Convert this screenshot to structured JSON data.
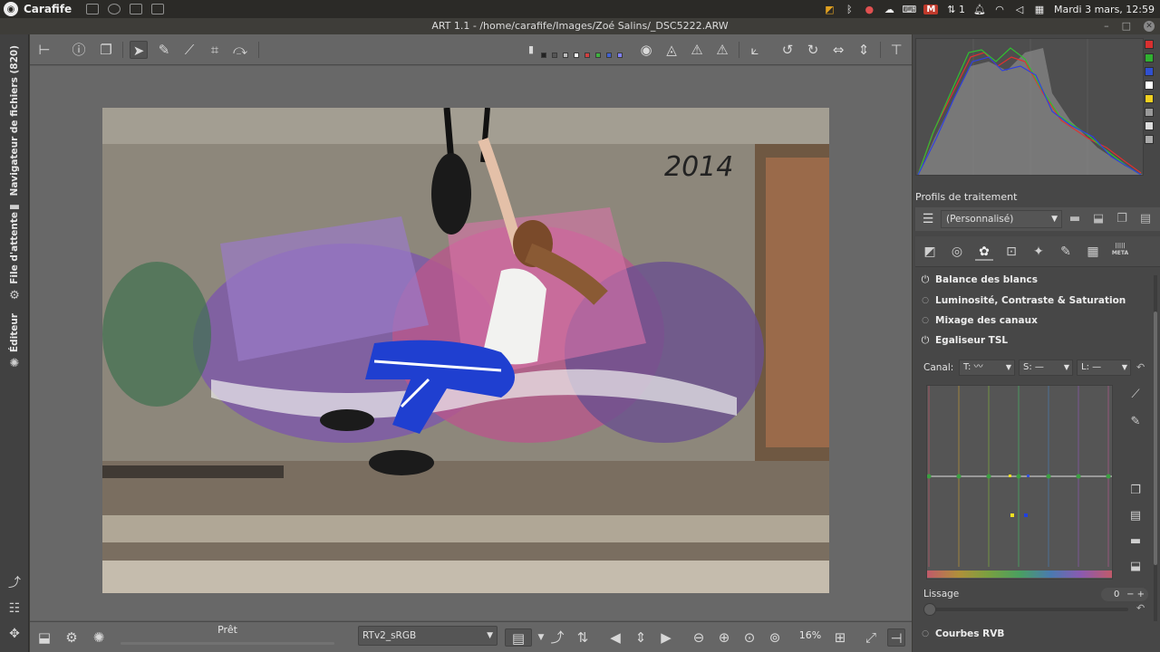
{
  "top_panel": {
    "app_name": "Carafife",
    "date_time": "Mardi 3 mars, 12:59",
    "notification_badge": "M",
    "notification_count": "1"
  },
  "window": {
    "title": "ART 1.1 - /home/carafife/Images/Zoé Salins/_DSC5222.ARW"
  },
  "left_tabs": {
    "file_browser": "Navigateur de fichiers (820)",
    "queue": "File d'attente",
    "editor": "Éditeur"
  },
  "editor": {
    "status_text": "Prêt",
    "output_profile": "RTv2_sRGB",
    "zoom_level": "16%",
    "swatch_colors": [
      "#222222",
      "#555555",
      "#bbbbbb",
      "#ffffff",
      "#d04040",
      "#40b040",
      "#4060d0",
      "#8080ff"
    ]
  },
  "right_panel": {
    "processing_profiles_label": "Profils de traitement",
    "processing_profile_value": "(Personnalisé)",
    "meta_tab_label": "META",
    "tools": [
      {
        "label": "Balance des blancs",
        "state": "on"
      },
      {
        "label": "Luminosité, Contraste & Saturation",
        "state": "dot"
      },
      {
        "label": "Mixage des canaux",
        "state": "dot"
      },
      {
        "label": "Egaliseur TSL",
        "state": "on"
      },
      {
        "label": "Courbes RVB",
        "state": "dot"
      }
    ],
    "tsl": {
      "canal_label": "Canal:",
      "channel_t": "T:",
      "channel_s": "S:",
      "channel_l": "L:",
      "smoothing_label": "Lissage",
      "smoothing_value": "0"
    },
    "histogram_button_colors": [
      "#d83030",
      "#30b030",
      "#3050d0",
      "#ffffff",
      "#f0d020",
      "#999999",
      "#dddddd",
      "#aaaaaa"
    ]
  }
}
